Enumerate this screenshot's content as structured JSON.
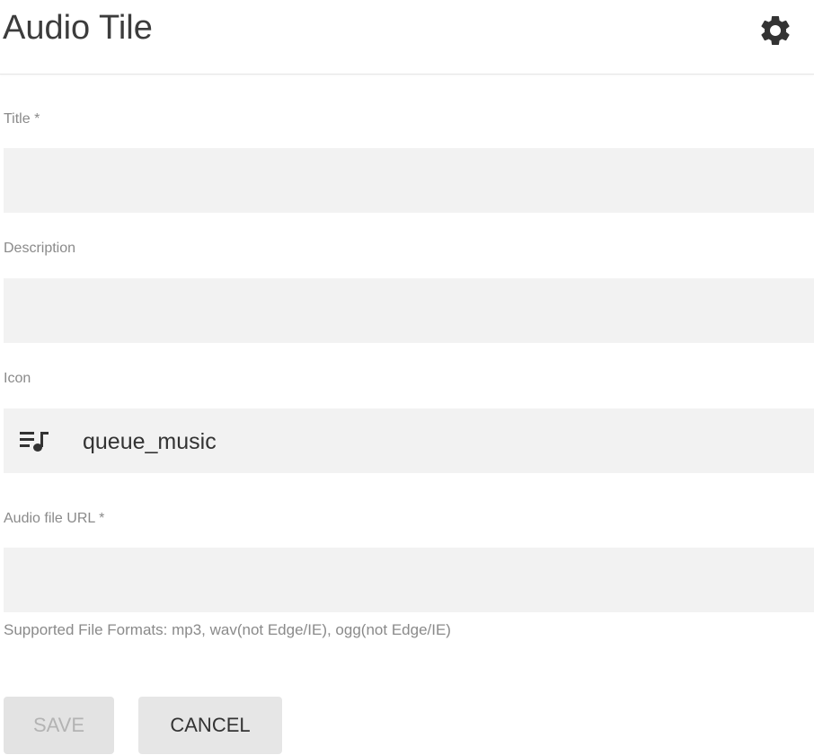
{
  "header": {
    "title": "Audio Tile",
    "settings_icon": "gear-icon"
  },
  "form": {
    "title": {
      "label": "Title *",
      "value": ""
    },
    "description": {
      "label": "Description",
      "value": ""
    },
    "icon": {
      "label": "Icon",
      "value": "queue_music",
      "icon_name": "queue-music-icon"
    },
    "audio_url": {
      "label": "Audio file URL *",
      "value": "",
      "helper_text": "Supported File Formats: mp3, wav(not Edge/IE), ogg(not Edge/IE)"
    }
  },
  "actions": {
    "save_label": "SAVE",
    "save_disabled": true,
    "cancel_label": "CANCEL"
  },
  "colors": {
    "input_background": "#f2f2f2",
    "label_text": "#8a8a8a",
    "disabled_text": "#b3b3b3"
  }
}
